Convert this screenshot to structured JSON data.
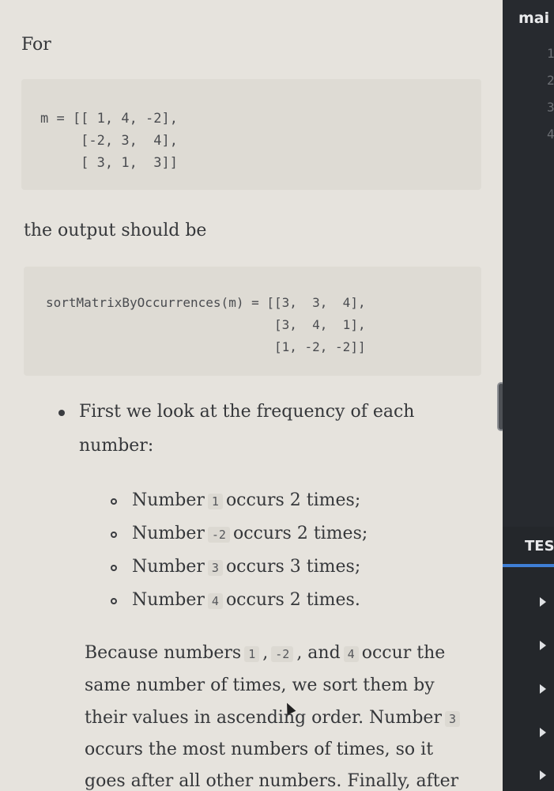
{
  "intro": "For",
  "matrix_input": {
    "lines": [
      "m = [[ 1, 4, -2],",
      "     [-2, 3,  4],",
      "     [ 3, 1,  3]]"
    ]
  },
  "output_intro": "the output should be",
  "matrix_output": {
    "lines": [
      "sortMatrixByOccurrences(m) = [[3,  3,  4],",
      "                              [3,  4,  1],",
      "                              [1, -2, -2]]"
    ]
  },
  "bullet_main": {
    "line1": "First we look at the frequency of each",
    "line2": "number:"
  },
  "occurrences": [
    {
      "prefix": "Number",
      "code": "1",
      "suffix": "occurs 2 times;"
    },
    {
      "prefix": "Number",
      "code": "-2",
      "suffix": "occurs 2 times;"
    },
    {
      "prefix": "Number",
      "code": "3",
      "suffix": "occurs 3 times;"
    },
    {
      "prefix": "Number",
      "code": "4",
      "suffix": "occurs 2 times."
    }
  ],
  "explanation": {
    "line1_a": "Because numbers",
    "line1_c1": "1",
    "line1_sep": ",",
    "line1_c2": "-2",
    "line1_b": ", and",
    "line1_c3": "4",
    "line1_c": "occur the",
    "line2": "same number of times, we sort them by",
    "line3_a": "their values in ascending order. Number",
    "line3_c": "3",
    "line4": "occurs the most numbers of times, so it",
    "line5": "goes after all other numbers. Finally, after"
  },
  "right_pane": {
    "top_tab": "mai",
    "line_numbers": [
      "1",
      "2",
      "3",
      "4"
    ],
    "section_tab": "TES",
    "accent": "#3f7fd6"
  }
}
